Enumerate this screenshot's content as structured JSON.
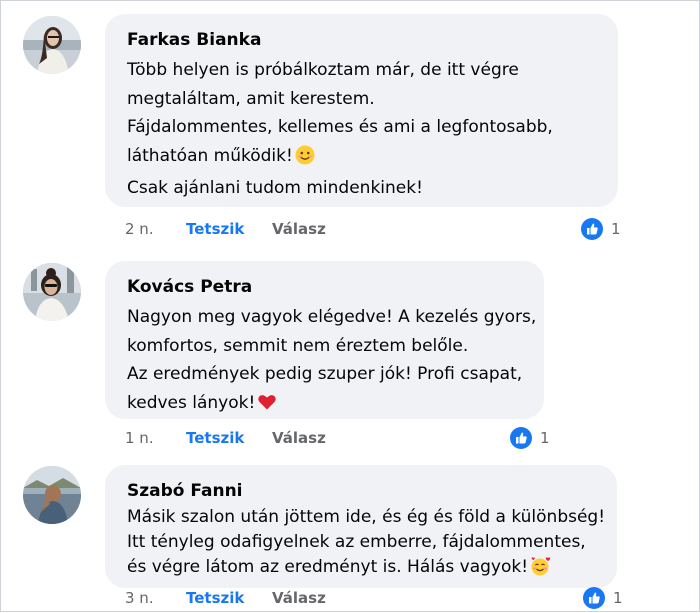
{
  "comments": [
    {
      "author": "Farkas Bianka",
      "lines": [
        "Több helyen is próbálkoztam már, de itt végre",
        "megtaláltam, amit kerestem.",
        "Fájdalommentes, kellemes és ami a legfontosabb,",
        "láthatóan működik!",
        "Csak ajánlani tudom mindenkinek!"
      ],
      "emoji_after_line_4": "smiling-face-emoji",
      "time": "2 n.",
      "like_label": "Tetszik",
      "reply_label": "Válasz",
      "reaction_count": "1"
    },
    {
      "author": "Kovács Petra",
      "lines": [
        "Nagyon meg vagyok elégedve! A kezelés gyors,",
        "komfortos, semmit nem éreztem belőle.",
        "Az eredmények pedig szuper jók! Profi csapat,",
        "kedves lányok!"
      ],
      "emoji_after_line_4": "red-heart-emoji",
      "time": "1 n.",
      "like_label": "Tetszik",
      "reply_label": "Válasz",
      "reaction_count": "1"
    },
    {
      "author": "Szabó Fanni",
      "lines": [
        "Másik szalon után jöttem ide, és ég és föld a különbség!",
        "Itt tényleg odafigyelnek az emberre, fájdalommentes,",
        "és végre látom az eredményt is. Hálás vagyok!"
      ],
      "emoji_after_line_3": "smiling-face-with-hearts-emoji",
      "time": "3 n.",
      "like_label": "Tetszik",
      "reply_label": "Válasz",
      "reaction_count": "1"
    }
  ],
  "colors": {
    "bubble": "#f0f2f5",
    "author": "#050505",
    "meta": "#65676b",
    "like_link": "#1877f2",
    "reaction_badge": "#1877f2"
  },
  "icons": {
    "reaction": "thumbs-up-icon"
  }
}
